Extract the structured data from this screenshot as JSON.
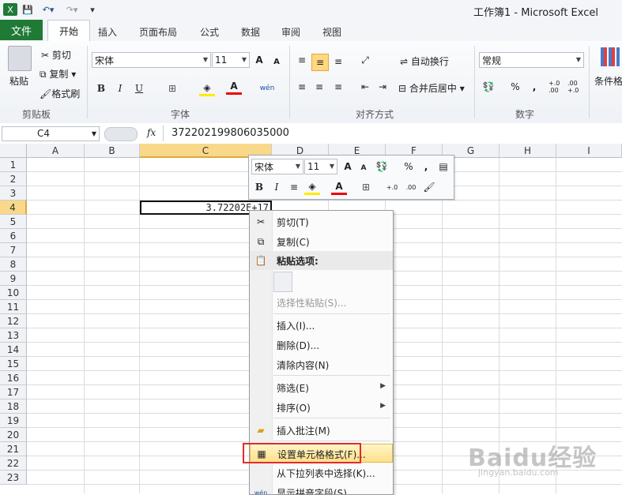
{
  "window": {
    "title": "工作簿1 - Microsoft Excel"
  },
  "tabs": [
    "文件",
    "开始",
    "插入",
    "页面布局",
    "公式",
    "数据",
    "审阅",
    "视图"
  ],
  "clipboard": {
    "paste": "粘贴",
    "cut": "剪切",
    "copy": "复制",
    "format_painter": "格式刷",
    "label": "剪贴板"
  },
  "font": {
    "name": "宋体",
    "size": "11",
    "bold": "B",
    "italic": "I",
    "underline": "U",
    "label": "字体",
    "grow": "A",
    "shrink": "A"
  },
  "alignment": {
    "wrap": "自动换行",
    "merge": "合并后居中",
    "label": "对齐方式"
  },
  "number": {
    "format": "常规",
    "percent": "%",
    "comma": ",",
    "inc_dec": "+.0 .00",
    "dec_dec": ".00 +.0",
    "label": "数字"
  },
  "styles": {
    "conditional": "条件格"
  },
  "formula_bar": {
    "name_box": "C4",
    "fx": "fx",
    "value": "372202199806035000"
  },
  "columns": [
    "A",
    "B",
    "C",
    "D",
    "E",
    "F",
    "G",
    "H",
    "I"
  ],
  "rows": [
    "1",
    "2",
    "3",
    "4",
    "5",
    "6",
    "7",
    "8",
    "9",
    "10",
    "11",
    "12",
    "13",
    "14",
    "15",
    "16",
    "17",
    "18",
    "19",
    "20",
    "21",
    "22",
    "23"
  ],
  "cell_c4": "3.72202E+17",
  "mini_toolbar": {
    "font": "宋体",
    "size": "11",
    "percent": "%",
    "comma": ",",
    "bold": "B",
    "italic": "I",
    "inc_dec": "+.0",
    "dec_dec": ".00"
  },
  "context_menu": {
    "cut": "剪切(T)",
    "copy": "复制(C)",
    "paste_options": "粘贴选项:",
    "paste_special": "选择性粘贴(S)...",
    "insert": "插入(I)...",
    "delete": "删除(D)...",
    "clear": "清除内容(N)",
    "filter": "筛选(E)",
    "sort": "排序(O)",
    "insert_comment": "插入批注(M)",
    "format_cells": "设置单元格格式(F)...",
    "pick_list": "从下拉列表中选择(K)...",
    "phonetic": "显示拼音字段(S)"
  },
  "watermark": {
    "main": "Baidu经验",
    "sub": "jingyan.baidu.com"
  },
  "colors": {
    "file_tab": "#1f7a36",
    "highlight": "#ffe08a",
    "red_box": "#e12b2b",
    "selected_col": "#f9d88a"
  }
}
